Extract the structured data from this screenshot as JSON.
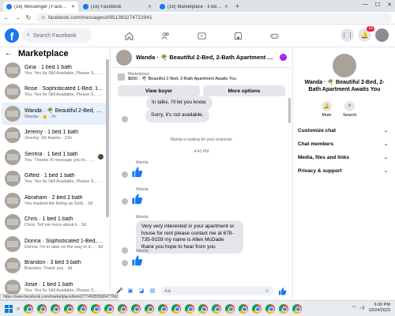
{
  "browser": {
    "tabs": [
      {
        "title": "(16) Messenger | Facebook",
        "active": true
      },
      {
        "title": "(16) Facebook",
        "active": false
      },
      {
        "title": "(16) Marketplace - Il Beautiful",
        "active": false
      }
    ],
    "url": "facebook.com/messages/t/851393274722941",
    "status_url": "https://www.facebook.com/marketplace/item/2774925558047766/?referralS..."
  },
  "header": {
    "logo": "f",
    "search_placeholder": "Search Facebook",
    "notification_count": "16"
  },
  "sidebar": {
    "title": "Marketplace",
    "conversations": [
      {
        "name": "Gina · 1 bed 1 bath",
        "snippet": "You: Yes Its Still Available, Please S... · 2m"
      },
      {
        "name": "Rose · Sophisticated 1-Bed, 1-Bath...",
        "snippet": "You: Yes Its Still Available, Please S... · 2m"
      },
      {
        "name": "Wanda · 🌴 Beautiful 2-Bed, 2-B...",
        "snippet": "Wanda · 👍 · 1h"
      },
      {
        "name": "Jeremy · 1 bed 1 bath",
        "snippet": "Jeremy: Ok thanks · 21h"
      },
      {
        "name": "Senhra · 1 bed 1 bath",
        "snippet": "You: Thanks i'll message you in... · 23h"
      },
      {
        "name": "Gifted · 1 bed 1 bath",
        "snippet": "You: Yes Its Still Available, Please S... · 1d"
      },
      {
        "name": "Abraham · 2 bed 2 bath",
        "snippet": "You marked the listing as Sold. · 2d"
      },
      {
        "name": "Chris · 1 bed 1 bath",
        "snippet": "Chris: Tell me more about it · 3d"
      },
      {
        "name": "Donna · Sophisticated 1-Bed, 1-B...",
        "snippet": "Donna: I'm in uber on the way to d... · 3d"
      },
      {
        "name": "Brandon · 3 bed 3 bath",
        "snippet": "Brandon: Thank you · 3d"
      },
      {
        "name": "Josie · 1 bed 1 bath",
        "snippet": "You: Yes Its Still Available, Please S... · 3d"
      }
    ]
  },
  "chat": {
    "title": "Wanda · 🌴 Beautiful 2-Bed, 2-Bath Apartment Awaits ...",
    "listing_category": "Marketplace",
    "listing_title": "$600 · 🌴 Beautiful 2-Bed, 2-Bath Apartment Awaits You",
    "view_buyer": "View buyer",
    "more_options": "More options",
    "quick_replies": [
      "In talks. I'll let you know.",
      "Sorry, it's not available."
    ],
    "waiting": "Wanda is waiting for your response.",
    "timestamp": "4:41 PM",
    "sender": "Wanda",
    "long_message": "Very very interested in your apartment or house for rent please contact me at 678-735-9159 my name is Allen McDade thank you hope to hear from you",
    "composer_placeholder": "Aa"
  },
  "details": {
    "title": "Wanda · 🌴 Beautiful 2-Bed, 2-Bath Apartment Awaits You",
    "mute": "Mute",
    "search": "Search",
    "menu": [
      "Customize chat",
      "Chat members",
      "Media, files and links",
      "Privacy & support"
    ]
  },
  "taskbar": {
    "time": "6:00 PM",
    "date": "10/24/2023"
  },
  "colors": {
    "brand": "#1877f2",
    "selected_bg": "#e7f0fd",
    "bubble": "#e4e6eb"
  }
}
